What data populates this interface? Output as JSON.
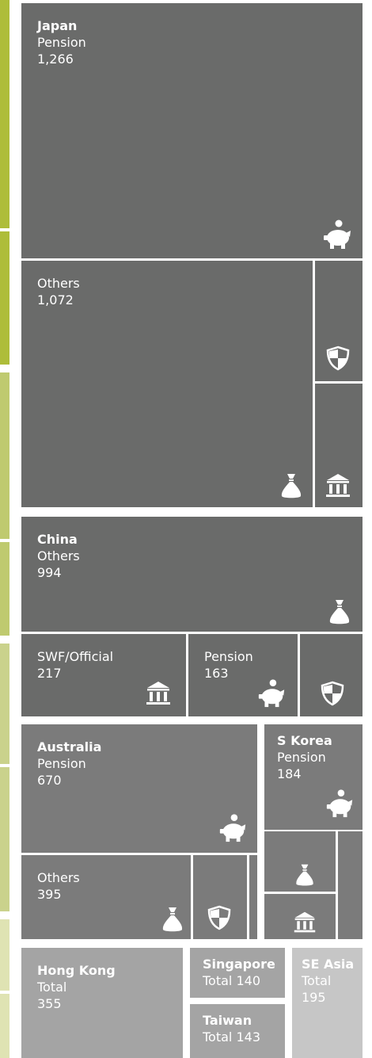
{
  "chart_data": {
    "type": "treemap",
    "units": "",
    "markets": [
      {
        "name": "Japan",
        "segments": [
          {
            "label": "Pension",
            "value": 1266,
            "display": "1,266",
            "icon": "piggy-bank-icon"
          },
          {
            "label": "Others",
            "value": 1072,
            "display": "1,072",
            "icon": "money-bag-icon"
          },
          {
            "label": "",
            "icon": "shield-icon"
          },
          {
            "label": "",
            "icon": "bank-icon"
          }
        ]
      },
      {
        "name": "China",
        "segments": [
          {
            "label": "Others",
            "value": 994,
            "display": "994",
            "icon": "money-bag-icon"
          },
          {
            "label": "SWF/Official",
            "value": 217,
            "display": "217",
            "icon": "bank-icon"
          },
          {
            "label": "Pension",
            "value": 163,
            "display": "163",
            "icon": "piggy-bank-icon"
          },
          {
            "label": "",
            "icon": "shield-icon"
          }
        ]
      },
      {
        "name": "Australia",
        "segments": [
          {
            "label": "Pension",
            "value": 670,
            "display": "670",
            "icon": "piggy-bank-icon"
          },
          {
            "label": "Others",
            "value": 395,
            "display": "395",
            "icon": "money-bag-icon"
          },
          {
            "label": "",
            "icon": "shield-icon"
          },
          {
            "label": ""
          }
        ]
      },
      {
        "name": "S Korea",
        "segments": [
          {
            "label": "Pension",
            "value": 184,
            "display": "184",
            "icon": "piggy-bank-icon"
          },
          {
            "label": "",
            "icon": "money-bag-icon"
          },
          {
            "label": "",
            "icon": "bank-icon"
          },
          {
            "label": ""
          }
        ]
      },
      {
        "name": "Hong Kong",
        "segments": [
          {
            "label": "Total",
            "value": 355,
            "display": "355"
          }
        ]
      },
      {
        "name": "Singapore",
        "segments": [
          {
            "label": "Total 140",
            "value": 140
          }
        ]
      },
      {
        "name": "Taiwan",
        "segments": [
          {
            "label": "Total 143",
            "value": 143
          }
        ]
      },
      {
        "name": "SE Asia",
        "segments": [
          {
            "label": "Total",
            "value": 195,
            "display": "195"
          }
        ]
      }
    ]
  },
  "colors": {
    "dark": "#6a6b6a",
    "mid": "#7b7b7b",
    "light": "#a4a4a4",
    "lighter": "#c6c6c6",
    "side_green_1": "#aebd3a",
    "side_green_2": "#bfca6f",
    "side_green_3": "#cad28c",
    "side_green_4": "#dfe3b3"
  }
}
